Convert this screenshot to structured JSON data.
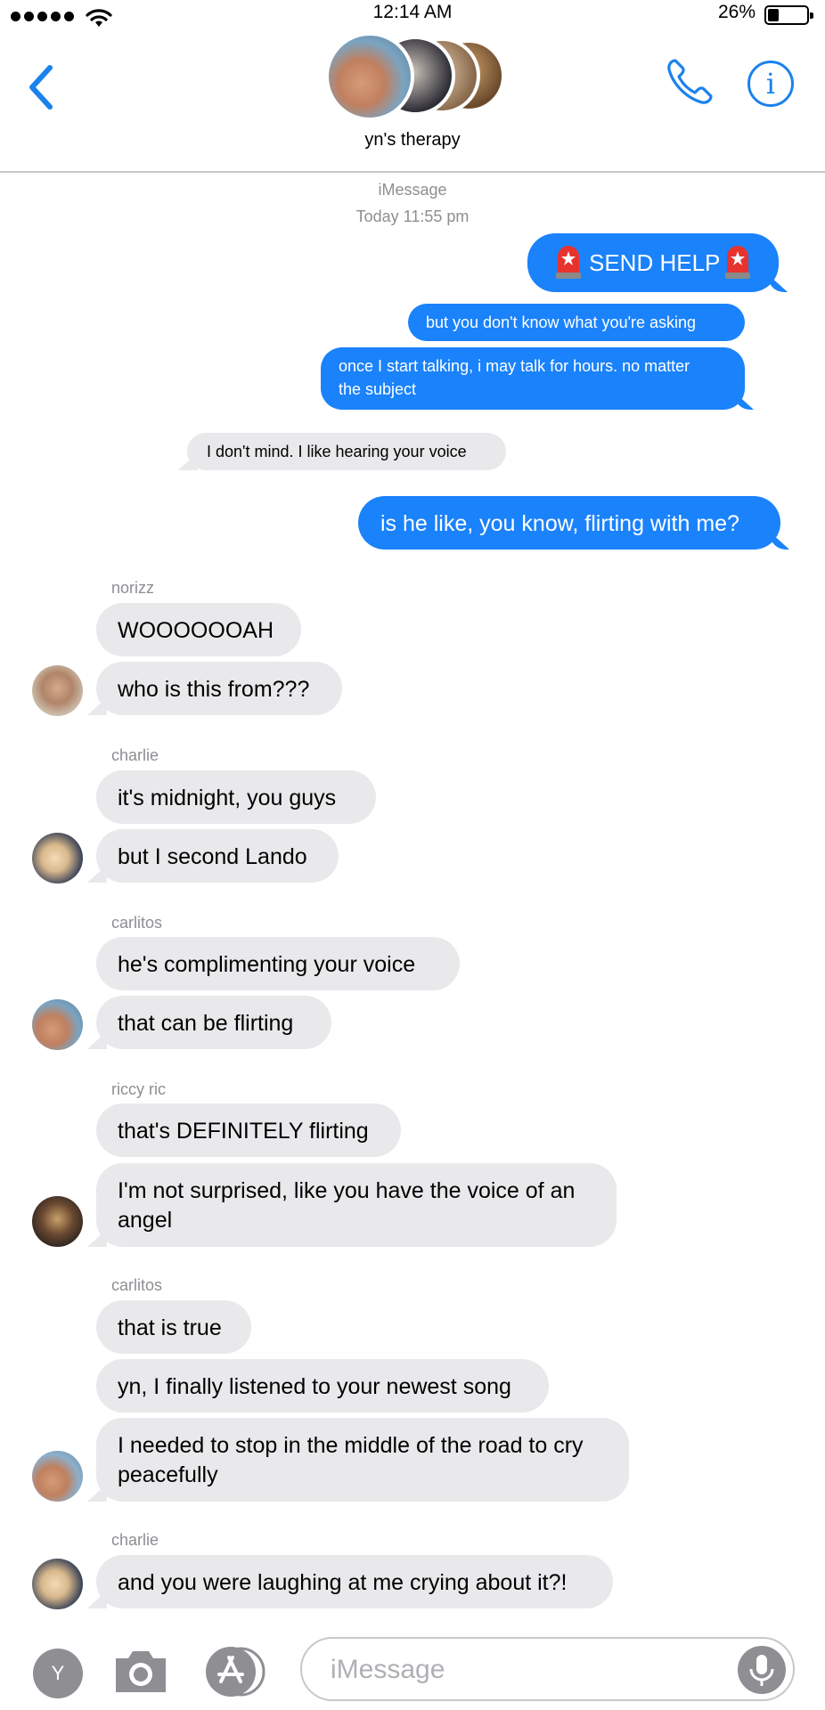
{
  "status_bar": {
    "time": "12:14 AM",
    "battery": "26%"
  },
  "header": {
    "group_name": "yn's therapy"
  },
  "thread": {
    "service": "iMessage",
    "timestamp": "Today 11:55 pm"
  },
  "outgoing": {
    "m1": "SEND HELP",
    "m2": "but you don't know what you're asking",
    "m3_line1": "once I start talking, i may talk for hours. no matter",
    "m3_line2": "the subject",
    "m5": "is he like, you know, flirting with me?"
  },
  "quoted": {
    "m4": "I don't mind. I like hearing your voice"
  },
  "groups": [
    {
      "sender": "norizz",
      "messages": [
        "WOOOOOOAH",
        "who is this from???"
      ]
    },
    {
      "sender": "charlie",
      "messages": [
        "it's midnight, you guys",
        "but I second Lando"
      ]
    },
    {
      "sender": "carlitos",
      "messages": [
        "he's complimenting your voice",
        "that can be flirting"
      ]
    },
    {
      "sender": "riccy ric",
      "messages": [
        "that's DEFINITELY flirting",
        "I'm not surprised, like you have the voice of an",
        "angel"
      ]
    },
    {
      "sender": "carlitos",
      "messages": [
        "that is true",
        "yn, I finally listened to your newest song",
        "I needed to stop in the middle of the road to cry",
        "peacefully"
      ]
    },
    {
      "sender": "charlie",
      "messages": [
        "and you were laughing at me crying about it?!"
      ]
    }
  ],
  "input": {
    "placeholder": "iMessage",
    "avatar_letter": "Y"
  },
  "colors": {
    "accent": "#1a82fb",
    "incoming": "#e9e9eb",
    "meta": "#8e8e93"
  },
  "icons": [
    "back-chevron-icon",
    "phone-icon",
    "info-icon",
    "camera-icon",
    "app-store-icon",
    "microphone-icon",
    "siren-emoji-icon"
  ]
}
